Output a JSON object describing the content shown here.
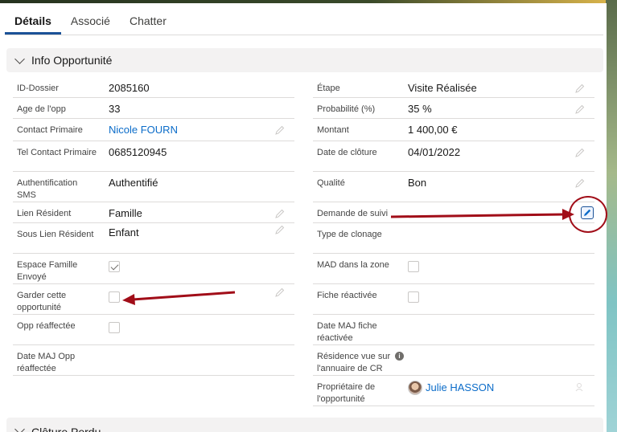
{
  "tabs": [
    {
      "label": "Détails",
      "active": true
    },
    {
      "label": "Associé",
      "active": false
    },
    {
      "label": "Chatter",
      "active": false
    }
  ],
  "section": {
    "title": "Info Opportunité"
  },
  "section2": {
    "title": "Clôture Perdu"
  },
  "left": {
    "dossier": {
      "label": "ID-Dossier",
      "value": "2085160"
    },
    "age": {
      "label": "Age de l'opp",
      "value": "33"
    },
    "contact": {
      "label": "Contact Primaire",
      "value": "Nicole FOURN"
    },
    "tel": {
      "label": "Tel Contact Primaire",
      "value": "0685120945"
    },
    "auth": {
      "label": "Authentification SMS",
      "value": "Authentifié"
    },
    "lien": {
      "label": "Lien Résident",
      "value": "Famille"
    },
    "souslien": {
      "label": "Sous Lien Résident",
      "value": "Enfant"
    },
    "espace": {
      "label": "Espace Famille Envoyé",
      "checked": true
    },
    "garder": {
      "label": "Garder cette opportunité",
      "checked": false
    },
    "reaffectee": {
      "label": "Opp réaffectée",
      "checked": false
    },
    "datemaj": {
      "label": "Date MAJ Opp réaffectée",
      "value": ""
    }
  },
  "right": {
    "etape": {
      "label": "Étape",
      "value": "Visite Réalisée"
    },
    "proba": {
      "label": "Probabilité (%)",
      "value": "35 %"
    },
    "montant": {
      "label": "Montant",
      "value": "1 400,00 €"
    },
    "cloture": {
      "label": "Date de clôture",
      "value": "04/01/2022"
    },
    "qualite": {
      "label": "Qualité",
      "value": "Bon"
    },
    "suivi": {
      "label": "Demande de suivi",
      "value": ""
    },
    "clonage": {
      "label": "Type de clonage",
      "value": ""
    },
    "mad": {
      "label": "MAD dans la zone",
      "checked": false
    },
    "fiche": {
      "label": "Fiche réactivée",
      "checked": false
    },
    "datefiche": {
      "label": "Date MAJ fiche réactivée",
      "value": ""
    },
    "residence": {
      "label": "Résidence vue sur l'annuaire de CR",
      "info_icon": "info-icon"
    },
    "owner": {
      "label": "Propriétaire de l'opportunité",
      "value": "Julie HASSON",
      "icon": "owner-change-icon"
    }
  },
  "colors": {
    "link": "#0b6cc9",
    "tab_underline": "#1b5297",
    "annotation": "#a10d18"
  },
  "icons": {
    "pencil": "pencil-icon",
    "chevron": "chevron-down-icon",
    "checkbox": "checkbox-icon"
  }
}
